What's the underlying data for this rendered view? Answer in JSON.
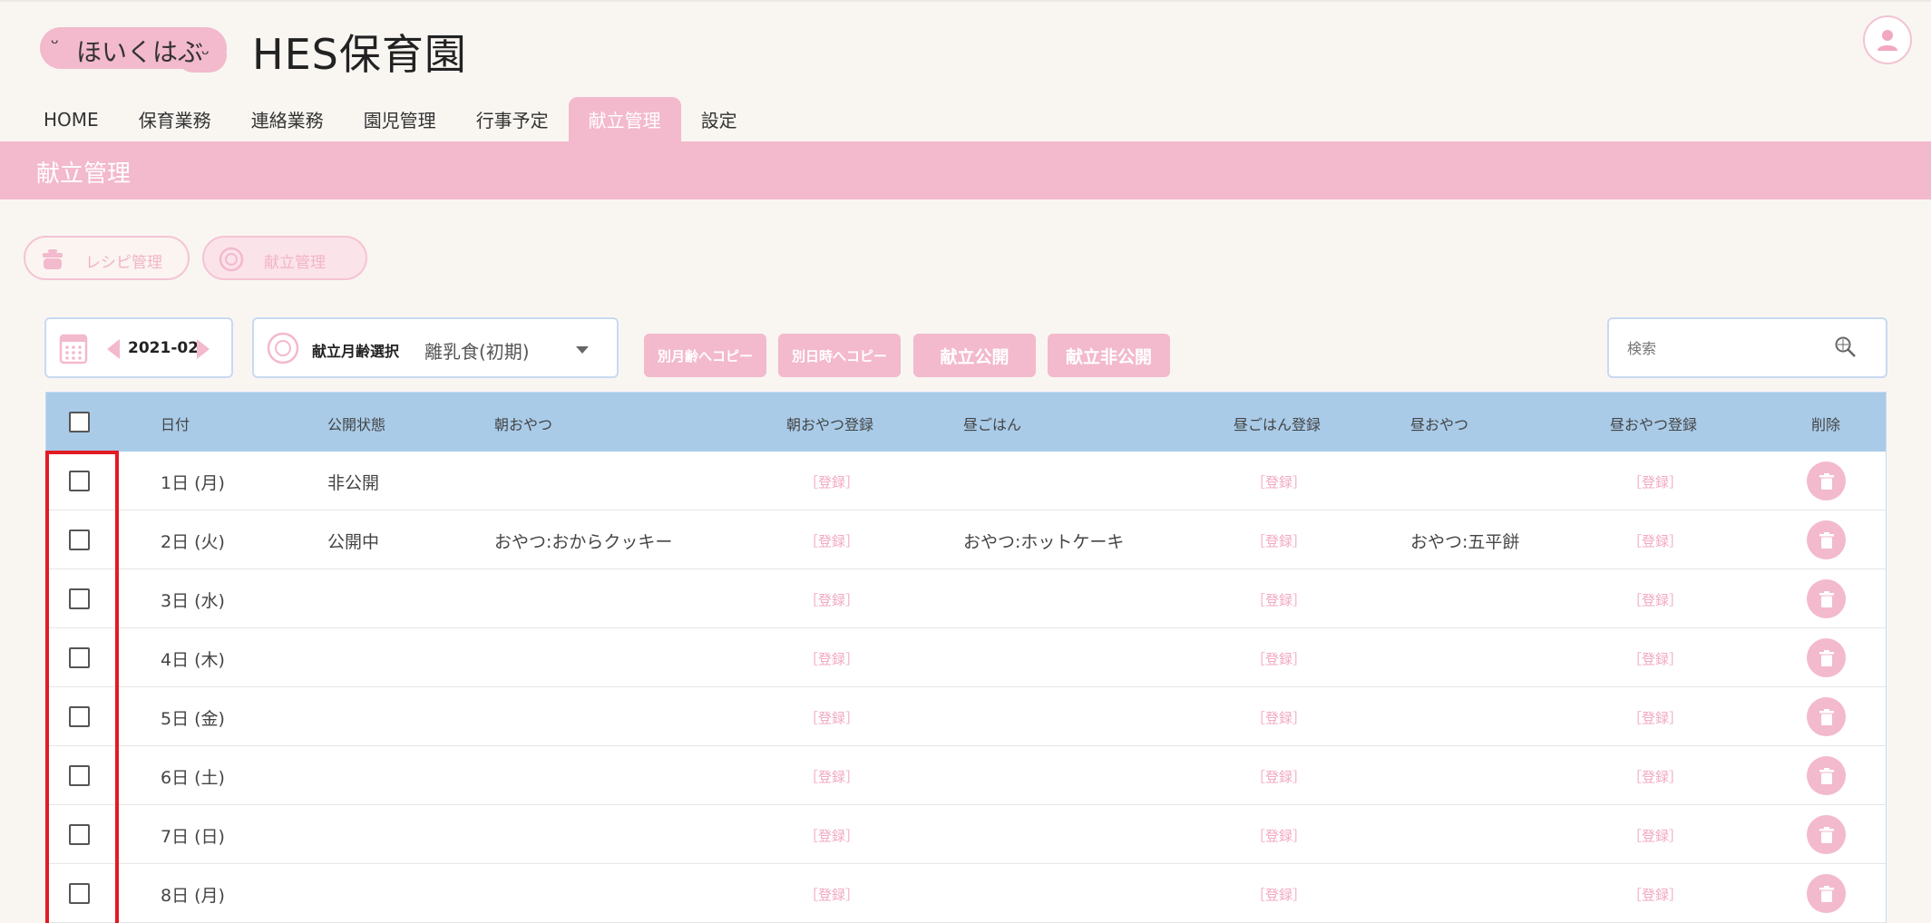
{
  "header": {
    "logo_text": "ほいくはぶ",
    "site_title": "HES保育園"
  },
  "nav": {
    "tabs": [
      {
        "label": "HOME"
      },
      {
        "label": "保育業務"
      },
      {
        "label": "連絡業務"
      },
      {
        "label": "園児管理"
      },
      {
        "label": "行事予定"
      },
      {
        "label": "献立管理",
        "active": true
      },
      {
        "label": "設定"
      }
    ]
  },
  "page_title": "献立管理",
  "sub_buttons": {
    "recipe": "レシピ管理",
    "menu": "献立管理"
  },
  "toolbar": {
    "month": "2021-02",
    "age_label": "献立月齢選択",
    "age_value": "離乳食(初期)",
    "copy_month_age": "別月齢へコピー",
    "copy_other_date": "別日時へコピー",
    "publish": "献立公開",
    "unpublish": "献立非公開",
    "search_placeholder": "検索"
  },
  "table": {
    "headers": {
      "date": "日付",
      "status": "公開状態",
      "morning_snack": "朝おやつ",
      "morning_snack_reg": "朝おやつ登録",
      "lunch": "昼ごはん",
      "lunch_reg": "昼ごはん登録",
      "afternoon_snack": "昼おやつ",
      "afternoon_snack_reg": "昼おやつ登録",
      "delete": "削除"
    },
    "register_label": "［登録］",
    "rows": [
      {
        "date": "1日 (月)",
        "status": "非公開",
        "morning_snack": "",
        "lunch": "",
        "afternoon_snack": ""
      },
      {
        "date": "2日 (火)",
        "status": "公開中",
        "morning_snack": "おやつ:おからクッキー",
        "lunch": "おやつ:ホットケーキ",
        "afternoon_snack": "おやつ:五平餅"
      },
      {
        "date": "3日 (水)",
        "status": "",
        "morning_snack": "",
        "lunch": "",
        "afternoon_snack": ""
      },
      {
        "date": "4日 (木)",
        "status": "",
        "morning_snack": "",
        "lunch": "",
        "afternoon_snack": ""
      },
      {
        "date": "5日 (金)",
        "status": "",
        "morning_snack": "",
        "lunch": "",
        "afternoon_snack": ""
      },
      {
        "date": "6日 (土)",
        "status": "",
        "morning_snack": "",
        "lunch": "",
        "afternoon_snack": ""
      },
      {
        "date": "7日 (日)",
        "status": "",
        "morning_snack": "",
        "lunch": "",
        "afternoon_snack": ""
      },
      {
        "date": "8日 (月)",
        "status": "",
        "morning_snack": "",
        "lunch": "",
        "afternoon_snack": ""
      }
    ]
  },
  "colors": {
    "brand_pink": "#f3b9cd",
    "header_blue": "#a9cbe8",
    "highlight_red": "#e11b24"
  },
  "icons": [
    "user-icon",
    "pot-icon",
    "plate-icon",
    "calendar-icon",
    "arrow-left-icon",
    "arrow-right-icon",
    "dropdown-caret-icon",
    "search-icon",
    "trash-icon"
  ]
}
